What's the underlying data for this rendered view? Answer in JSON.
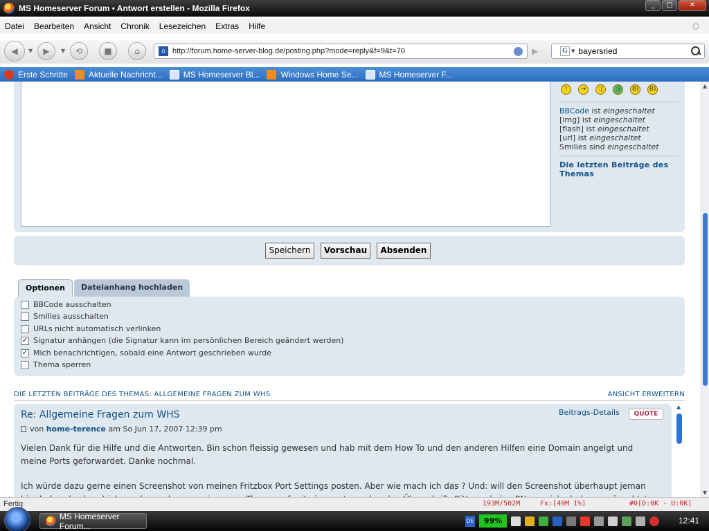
{
  "window": {
    "title": "MS Homeserver Forum • Antwort erstellen - Mozilla Firefox",
    "buttons": [
      "_",
      "□",
      "✕"
    ]
  },
  "menu": [
    "Datei",
    "Bearbeiten",
    "Ansicht",
    "Chronik",
    "Lesezeichen",
    "Extras",
    "Hilfe"
  ],
  "toolbar": {
    "url": "http://forum.home-server-blog.de/posting.php?mode=reply&f=9&t=70",
    "search_engine": "G",
    "search_query": "bayersried"
  },
  "bookmarks": [
    {
      "label": "Erste Schritte",
      "icon": "red"
    },
    {
      "label": "Aktuelle Nachricht...",
      "icon": "rss"
    },
    {
      "label": "MS Homeserver Bl...",
      "icon": "home"
    },
    {
      "label": "Windows Home Se...",
      "icon": "rss"
    },
    {
      "label": "MS Homeserver F...",
      "icon": "home"
    }
  ],
  "sidebar": {
    "bbcode_link": "BBCode",
    "lines": [
      {
        "prefix": "",
        "verb": " ist ",
        "state": "eingeschaltet"
      },
      {
        "prefix": "[img]",
        "verb": " ist ",
        "state": "eingeschaltet"
      },
      {
        "prefix": "[flash]",
        "verb": " ist ",
        "state": "eingeschaltet"
      },
      {
        "prefix": "[url]",
        "verb": " ist ",
        "state": "eingeschaltet"
      },
      {
        "prefix": "Smilies",
        "verb": " sind ",
        "state": "eingeschaltet"
      }
    ],
    "recent_title": "Die letzten Beiträge des Themas"
  },
  "buttons": {
    "save": "Speichern",
    "preview": "Vorschau",
    "submit": "Absenden"
  },
  "tabs": {
    "options": "Optionen",
    "attachments": "Dateianhang hochladen"
  },
  "options": [
    {
      "label": "BBCode ausschalten",
      "checked": false
    },
    {
      "label": "Smilies ausschalten",
      "checked": false
    },
    {
      "label": "URLs nicht automatisch verlinken",
      "checked": false
    },
    {
      "label": "Signatur anhängen (die Signatur kann im persönlichen Bereich geändert werden)",
      "checked": true
    },
    {
      "label": "Mich benachrichtigen, sobald eine Antwort geschrieben wurde",
      "checked": true
    },
    {
      "label": "Thema sperren",
      "checked": false
    }
  ],
  "recent": {
    "heading": "DIE LETZTEN BEITRÄGE DES THEMAS: ALLGEMEINE FRAGEN ZUM WHS",
    "expand": "ANSICHT ERWEITERN"
  },
  "post": {
    "title": "Re: Allgemeine Fragen zum WHS",
    "by": "von",
    "author": "home-terence",
    "date": "am So Jun 17, 2007 12:39 pm",
    "details": "Beitrags-Details",
    "quote": "QUOTE",
    "paragraphs": [
      "Vielen Dank für die Hilfe und die Antworten. Bin schon fleissig gewesen und hab mit dem How To und den anderen Hilfen eine Domain angelgt und meine Ports geforwardet. Danke nochmal.",
      "Ich würde dazu gerne einen Screenshot von meinen Fritzbox Port Settings posten. Aber wie mach ich das ? Und: will den Screenshot überhaupt jeman hier haben ( sehen ) ich mache auch gerne ein neues Thema auf mit einer entsprechenden Überschrift. Bitte mal eine PN ge mich ob das gewünscht / erlaubt ist."
    ]
  },
  "status": {
    "text": "Fertig",
    "memory": "193M/502M",
    "fx": "Fx:[49M  1%]",
    "downloads": "#0[D:0K - U:0K]"
  },
  "taskbar": {
    "window_item": "MS Homeserver Forum...",
    "language": "DE",
    "battery": "99%",
    "clock": "12:41"
  }
}
